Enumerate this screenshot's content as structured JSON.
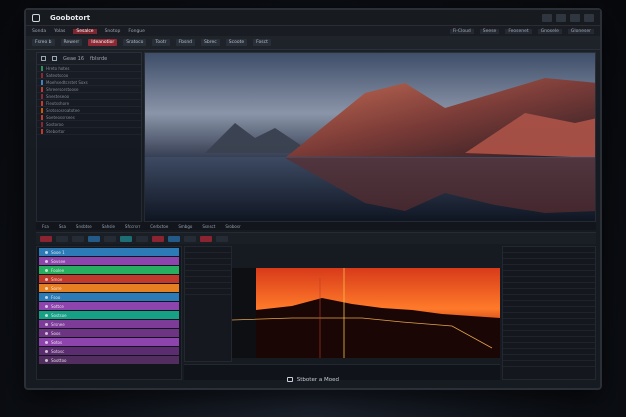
{
  "app": {
    "title": "Goobotort"
  },
  "menu": {
    "items": [
      "Sonda",
      "Yolas",
      "Sesalce",
      "Snotop",
      "Fongue"
    ],
    "active_index": 2,
    "right": [
      "Fi-Cloud",
      "Seese",
      "Feosenet",
      "Gnosele",
      "Gloneser"
    ]
  },
  "toolbar": {
    "items": [
      "Fsreo b",
      "Rewerr",
      "Ideanotior",
      "Sratoco",
      "Tootr",
      "Fbsnd",
      "Sbrec",
      "Scoote",
      "Fosct"
    ]
  },
  "layers": {
    "header": [
      "Geae 16",
      "fblsrde"
    ],
    "rows": [
      {
        "label": "Hreto hotes",
        "color": "#2e8b57"
      },
      {
        "label": "Sateotscoo",
        "color": "#8a2430"
      },
      {
        "label": "Moehsedtcrstet Soxs",
        "color": "#3f7fbf"
      },
      {
        "label": "Shreersorstoose",
        "color": "#c0392b"
      },
      {
        "label": "Snesteseoo",
        "color": "#8a2430"
      },
      {
        "label": "Fleotsshore",
        "color": "#c0392b"
      },
      {
        "label": "Srotssosroatotee",
        "color": "#d35400"
      },
      {
        "label": "Soeteossrsees",
        "color": "#c0392b"
      },
      {
        "label": "Sostoroo",
        "color": "#8a2430"
      },
      {
        "label": "Stebortor",
        "color": "#c0392b"
      }
    ]
  },
  "status": {
    "items": [
      "Fsa",
      "Ssa",
      "Snsbtse",
      "Sahsle",
      "Sfccrsrr",
      "Cerbctoe",
      "Smbgo",
      "Ssnsct",
      "Srobosr"
    ]
  },
  "tracks": [
    {
      "name": "Sooe 1",
      "color": "#2c7bb6"
    },
    {
      "name": "Sovsee",
      "color": "#8e44ad"
    },
    {
      "name": "Foolee",
      "color": "#27ae60"
    },
    {
      "name": "Smoe",
      "color": "#c0392b"
    },
    {
      "name": "Sorre",
      "color": "#e67e22"
    },
    {
      "name": "Fsoo",
      "color": "#2c7bb6"
    },
    {
      "name": "Sottce",
      "color": "#8e44ad"
    },
    {
      "name": "Sostsoe",
      "color": "#16a085"
    },
    {
      "name": "Srsnee",
      "color": "#7d3c98"
    },
    {
      "name": "Soos",
      "color": "#6c3483"
    },
    {
      "name": "Sotos",
      "color": "#8e44ad"
    },
    {
      "name": "Sotosc",
      "color": "#5b2c6f"
    },
    {
      "name": "Soottoo",
      "color": "#512e5f"
    }
  ],
  "caption": "Stboter a Moed",
  "colors": {
    "accent_red": "#8a2430",
    "accent_blue": "#235a88"
  }
}
